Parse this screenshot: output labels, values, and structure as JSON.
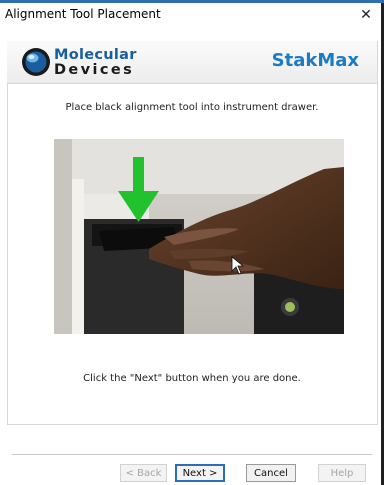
{
  "window": {
    "title": "Alignment Tool Placement",
    "close_glyph": "✕"
  },
  "banner": {
    "logo_line1": "Molecular",
    "logo_line2": "Devices",
    "product": "StakMax"
  },
  "main": {
    "instruction_top": "Place black alignment tool into instrument drawer.",
    "instruction_bottom": "Click the \"Next\" button when you are done."
  },
  "buttons": {
    "back": "< Back",
    "next": "Next >",
    "cancel": "Cancel",
    "help": "Help"
  },
  "colors": {
    "brand_blue": "#1b5ea0",
    "product_blue": "#1b7bc3",
    "arrow_green": "#22c22e"
  }
}
